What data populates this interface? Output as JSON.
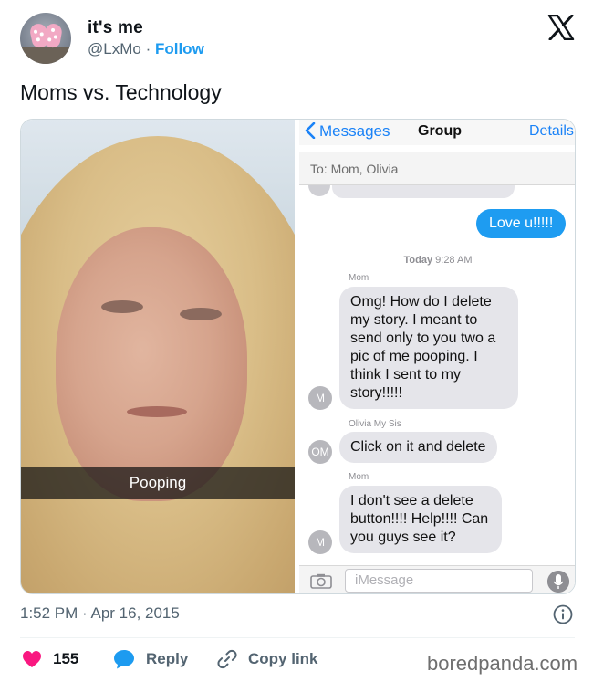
{
  "tweet": {
    "display_name": "it's me",
    "handle": "@LxMo",
    "separator": "·",
    "follow_label": "Follow",
    "text": "Moms vs. Technology",
    "timestamp": "1:52 PM · Apr 16, 2015"
  },
  "media": {
    "photo_caption": "Pooping",
    "imessage": {
      "back_label": "Messages",
      "title": "Group",
      "details_label": "Details",
      "to_line": "To: Mom, Olivia",
      "sent_message": "Love u!!!!!",
      "time_day": "Today",
      "time_clock": "9:28 AM",
      "messages": [
        {
          "sender": "Mom",
          "initials": "M",
          "text": "Omg!  How do I delete my story. I meant to send only to you two a pic of me pooping. I think I sent to my story!!!!!"
        },
        {
          "sender": "Olivia My Sis",
          "initials": "OM",
          "text": "Click on it and delete"
        },
        {
          "sender": "Mom",
          "initials": "M",
          "text": "I don't see a delete button!!!! Help!!!!  Can you guys see it?"
        }
      ],
      "input_placeholder": "iMessage"
    }
  },
  "actions": {
    "like_count": "155",
    "reply_label": "Reply",
    "copy_label": "Copy link"
  },
  "watermark": "boredpanda.com",
  "colors": {
    "follow_blue": "#1d9bf0",
    "like_pink": "#f91880",
    "imessage_blue": "#1e9cf1",
    "ios_link_blue": "#1a82f7"
  },
  "icons": [
    "x-logo-icon",
    "back-chevron-icon",
    "camera-icon",
    "microphone-icon",
    "info-icon",
    "heart-icon",
    "reply-bubble-icon",
    "link-icon"
  ]
}
